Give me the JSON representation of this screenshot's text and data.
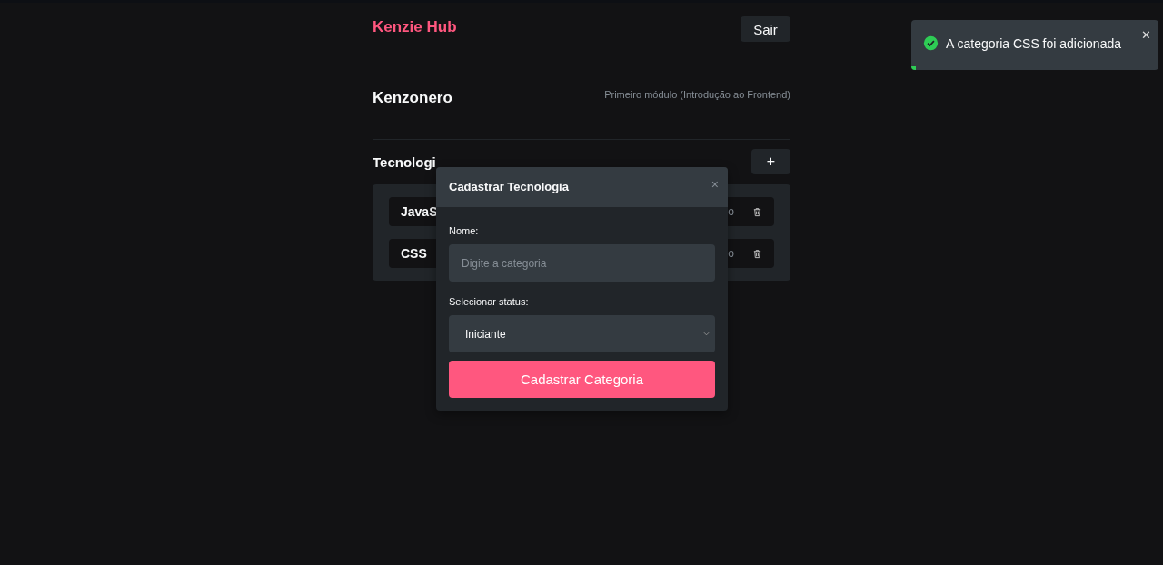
{
  "header": {
    "logo": "Kenzie Hub",
    "logout_button": "Sair"
  },
  "profile": {
    "name": "Kenzonero",
    "module": "Primeiro módulo (Introdução ao Frontend)"
  },
  "technologies": {
    "title": "Tecnologi",
    "add_button": "+",
    "items": [
      {
        "name": "JavaS",
        "status": "o"
      },
      {
        "name": "CSS",
        "status": "o"
      }
    ]
  },
  "modal": {
    "title": "Cadastrar Tecnologia",
    "close": "×",
    "name_label": "Nome:",
    "name_placeholder": "Digite a categoria",
    "status_label": "Selecionar status:",
    "status_value": "Iniciante",
    "submit": "Cadastrar Categoria"
  },
  "toast": {
    "message": "A categoria CSS foi adicionada",
    "close": "✕",
    "level": 0.02
  }
}
